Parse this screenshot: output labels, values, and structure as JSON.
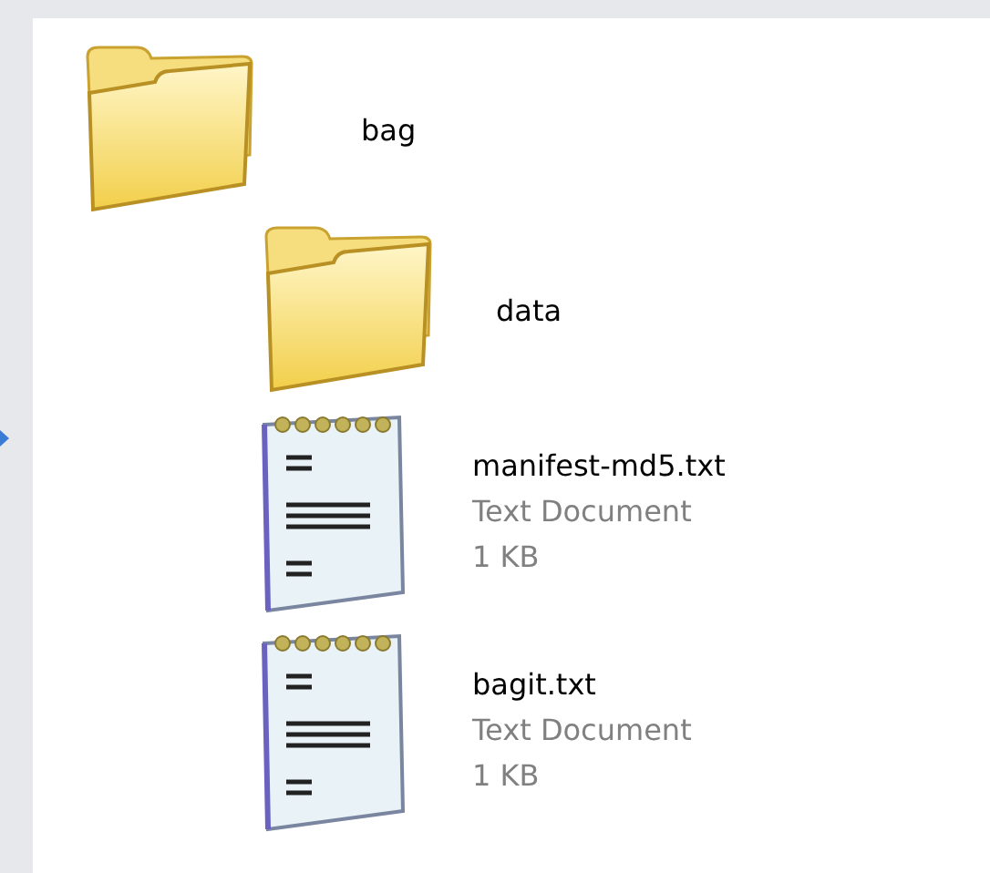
{
  "items": [
    {
      "kind": "folder",
      "name": "bag",
      "children": [
        {
          "kind": "folder",
          "name": "data"
        },
        {
          "kind": "text",
          "name": "manifest-md5.txt",
          "type": "Text Document",
          "size": "1 KB"
        },
        {
          "kind": "text",
          "name": "bagit.txt",
          "type": "Text Document",
          "size": "1 KB"
        }
      ]
    }
  ]
}
